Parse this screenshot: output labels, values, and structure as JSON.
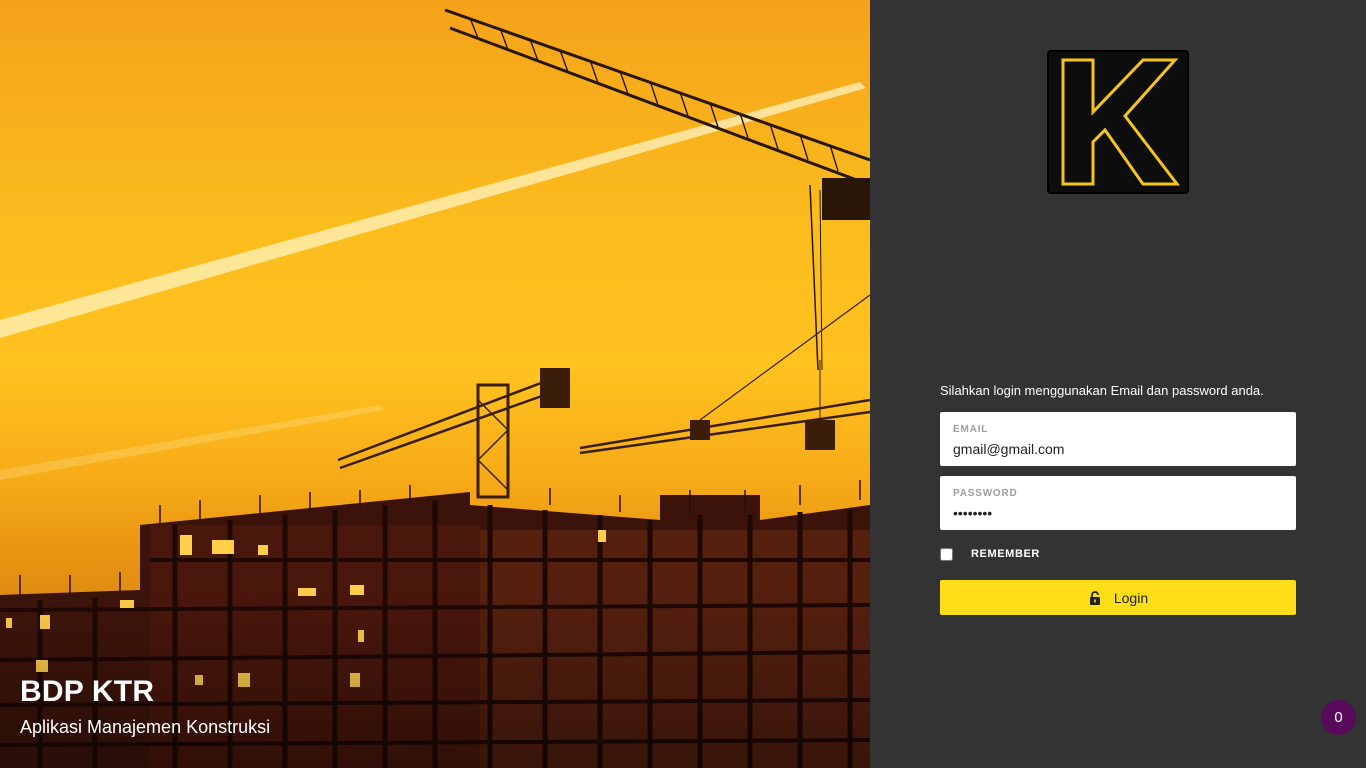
{
  "hero": {
    "title": "BDP KTR",
    "subtitle": "Aplikasi Manajemen Konstruksi",
    "image": "construction-site-sunset-cranes"
  },
  "logo": {
    "letter": "K",
    "colors": {
      "background": "#0d0d0d",
      "stroke": "#f5c518",
      "frame": "#000000"
    }
  },
  "login": {
    "instructions": "Silahkan login menggunakan Email dan password anda.",
    "email_label": "EMAIL",
    "email_value": "gmail@gmail.com",
    "password_label": "PASSWORD",
    "password_value": "password",
    "remember_label": "REMEMBER",
    "remember_checked": false,
    "button_label": "Login",
    "button_icon": "unlock-icon"
  },
  "badge": {
    "count": "0"
  },
  "colors": {
    "panel_bg": "#333333",
    "accent": "#fdde18",
    "badge_bg": "#5a0a5a"
  }
}
